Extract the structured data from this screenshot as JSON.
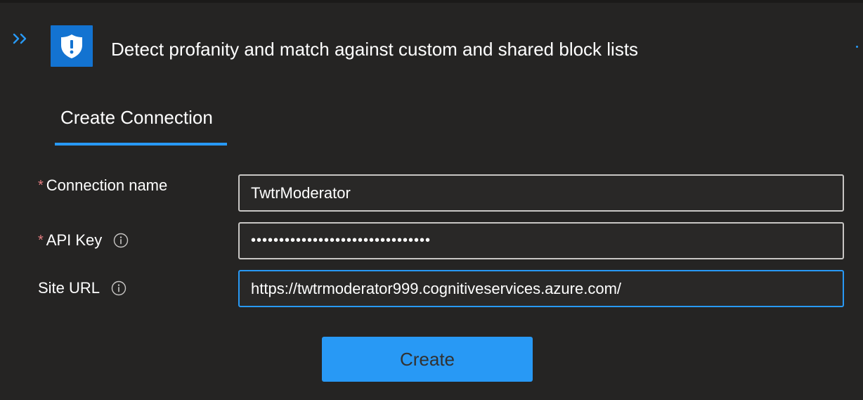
{
  "header": {
    "title": "Detect profanity and match against custom and shared block lists",
    "expand_icon": "double-chevron-right-icon",
    "app_icon": "shield-exclamation-icon"
  },
  "tabs": [
    {
      "label": "Create Connection",
      "selected": true
    }
  ],
  "form": {
    "connection_name": {
      "label": "Connection name",
      "required": "*",
      "value": "TwtrModerator"
    },
    "api_key": {
      "label": "API Key",
      "required": "*",
      "value": "••••••••••••••••••••••••••••••••",
      "info_icon": "info-icon"
    },
    "site_url": {
      "label": "Site URL",
      "value": "https://twtrmoderator999.cognitiveservices.azure.com/",
      "info_icon": "info-icon"
    }
  },
  "actions": {
    "create_label": "Create"
  },
  "colors": {
    "background": "#252423",
    "accent": "#2899f5",
    "icon_box": "#1373d1",
    "required": "#e37d80",
    "input_border": "#c8c6c4"
  }
}
